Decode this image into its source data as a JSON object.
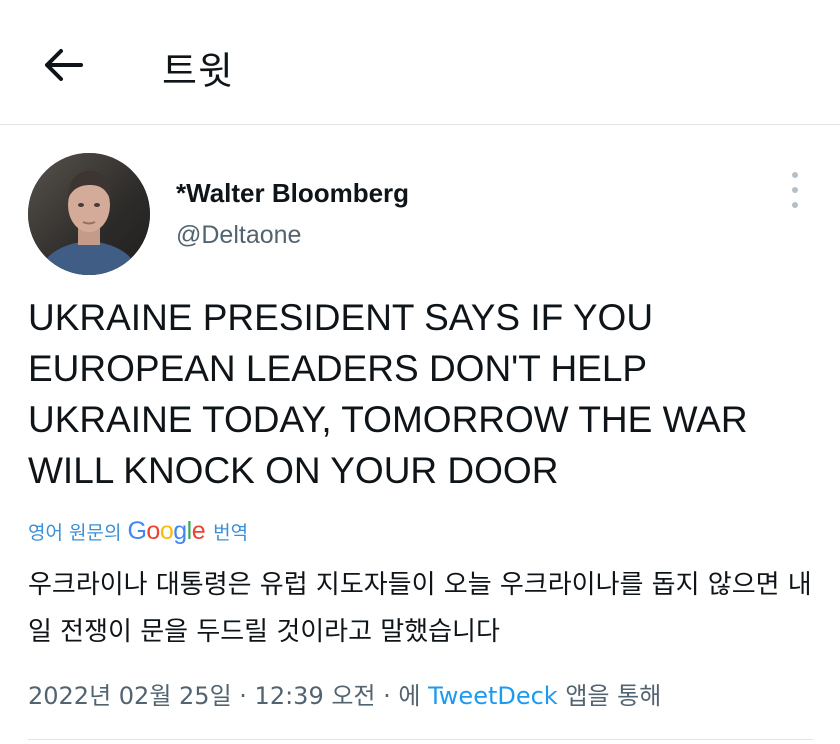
{
  "header": {
    "back_icon": "arrow-left-icon",
    "title": "트윗"
  },
  "author": {
    "display_name": "*Walter Bloomberg",
    "handle": "@Deltaone",
    "avatar_icon": "user-avatar"
  },
  "more_icon": "more-vertical-icon",
  "tweet": {
    "text": "UKRAINE PRESIDENT SAYS IF YOU EUROPEAN LEADERS DON'T HELP UKRAINE TODAY, TOMORROW THE WAR WILL KNOCK ON YOUR DOOR"
  },
  "translation": {
    "prefix": "영어 원문의",
    "provider": "Google",
    "suffix": "번역",
    "text": "우크라이나 대통령은 유럽 지도자들이 오늘 우크라이나를 돕지 않으면 내일 전쟁이 문을 두드릴 것이라고 말했습니다"
  },
  "meta": {
    "date": "2022년 02월 25일",
    "separator1": " · ",
    "time": "12:39 오전",
    "separator2": " · ",
    "via_prefix": "에 ",
    "client": "TweetDeck",
    "via_suffix": " 앱을 통해"
  },
  "colors": {
    "link_blue": "#1d9bf0",
    "secondary_text": "#536471",
    "google_blue": "#4285F4",
    "google_red": "#EA4335",
    "google_yellow": "#FBBC05",
    "google_green": "#34A853"
  }
}
